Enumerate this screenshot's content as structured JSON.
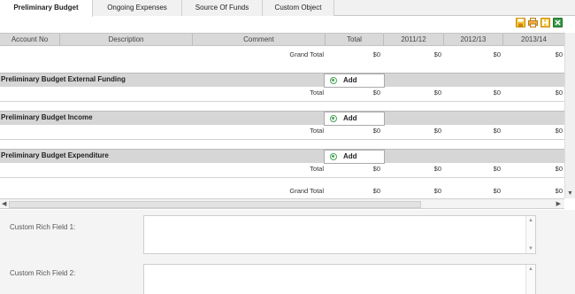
{
  "tabs": [
    {
      "label": "Preliminary Budget",
      "active": true
    },
    {
      "label": "Ongoing Expenses",
      "active": false
    },
    {
      "label": "Source Of Funds",
      "active": false
    },
    {
      "label": "Custom Object",
      "active": false
    }
  ],
  "toolbar": {
    "icons": [
      "save-icon",
      "print-icon",
      "export-icon",
      "excel-icon"
    ],
    "colors": {
      "save": "#e8a200",
      "print": "#e09a2a",
      "export": "#e8a200",
      "excel": "#2f8f3f"
    }
  },
  "columns": [
    "Account No",
    "Description",
    "Comment",
    "Total",
    "2011/12",
    "2012/13",
    "2013/14"
  ],
  "grand_total_top": {
    "label": "Grand Total",
    "values": [
      "$0",
      "$0",
      "$0",
      "$0"
    ]
  },
  "sections": [
    {
      "title": "Preliminary Budget External Funding",
      "add_label": "Add",
      "total_label": "Total",
      "values": [
        "$0",
        "$0",
        "$0",
        "$0"
      ]
    },
    {
      "title": "Preliminary Budget Income",
      "add_label": "Add",
      "total_label": "Total",
      "values": [
        "$0",
        "$0",
        "$0",
        "$0"
      ]
    },
    {
      "title": "Preliminary Budget Expenditure",
      "add_label": "Add",
      "total_label": "Total",
      "values": [
        "$0",
        "$0",
        "$0",
        "$0"
      ]
    }
  ],
  "grand_total_bottom": {
    "label": "Grand Total",
    "values": [
      "$0",
      "$0",
      "$0",
      "$0"
    ]
  },
  "fields": [
    {
      "label": "Custom Rich Field 1:",
      "value": ""
    },
    {
      "label": "Custom Rich Field 2:",
      "value": ""
    }
  ],
  "scroll": {
    "up": "▲",
    "down": "▼",
    "left": "◀",
    "right": "▶"
  }
}
